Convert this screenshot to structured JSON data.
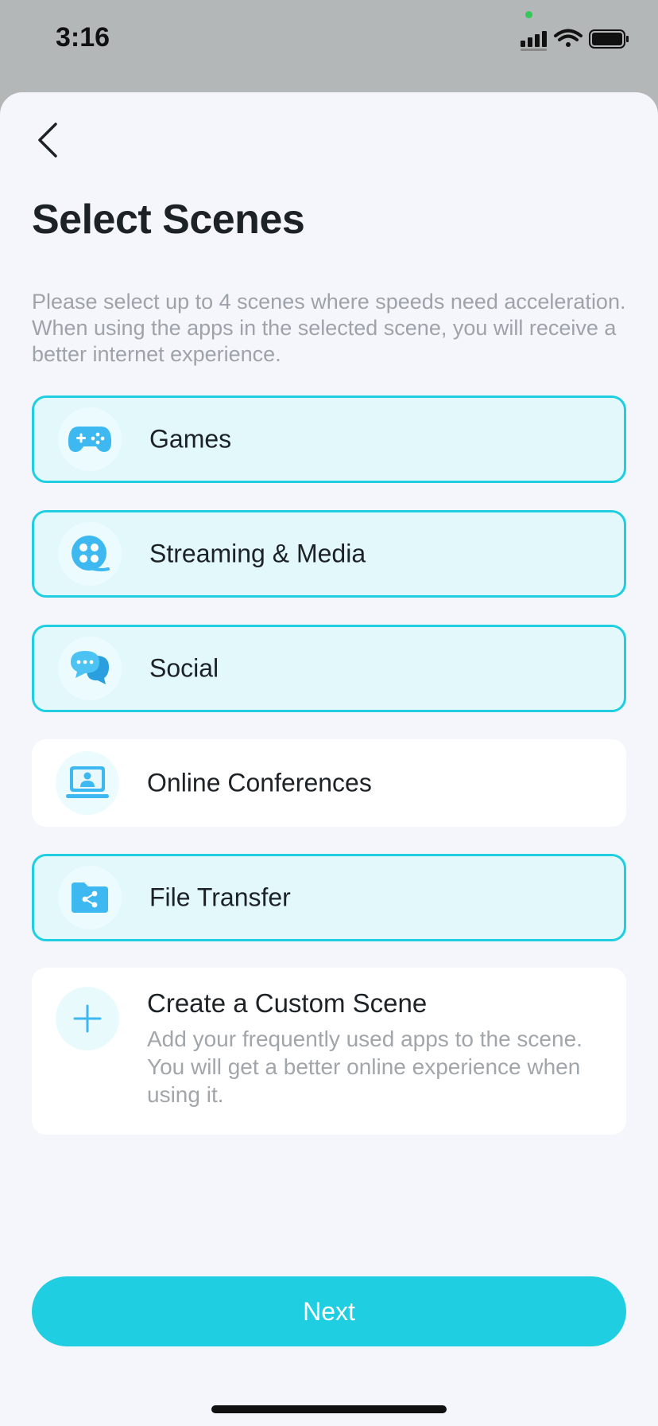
{
  "status": {
    "time": "3:16"
  },
  "header": {
    "title": "Select Scenes"
  },
  "description": "Please select up to 4 scenes where speeds need acceleration. When using the apps in the selected scene, you will receive a better internet experience.",
  "scenes": [
    {
      "label": "Games",
      "icon": "gamepad-icon",
      "selected": true
    },
    {
      "label": "Streaming & Media",
      "icon": "film-reel-icon",
      "selected": true
    },
    {
      "label": "Social",
      "icon": "chat-bubbles-icon",
      "selected": true
    },
    {
      "label": "Online Conferences",
      "icon": "laptop-user-icon",
      "selected": false
    },
    {
      "label": "File Transfer",
      "icon": "folder-share-icon",
      "selected": true
    }
  ],
  "custom_scene": {
    "title": "Create a Custom Scene",
    "description": "Add your frequently used apps to the scene. You will get a better online experience when using it.",
    "icon": "plus-icon"
  },
  "footer": {
    "next_label": "Next"
  },
  "colors": {
    "accent": "#1fcfe1",
    "icon_blue": "#3db8f0",
    "selected_bg": "#e2f8fb",
    "sheet_bg": "#f4f6fb"
  }
}
